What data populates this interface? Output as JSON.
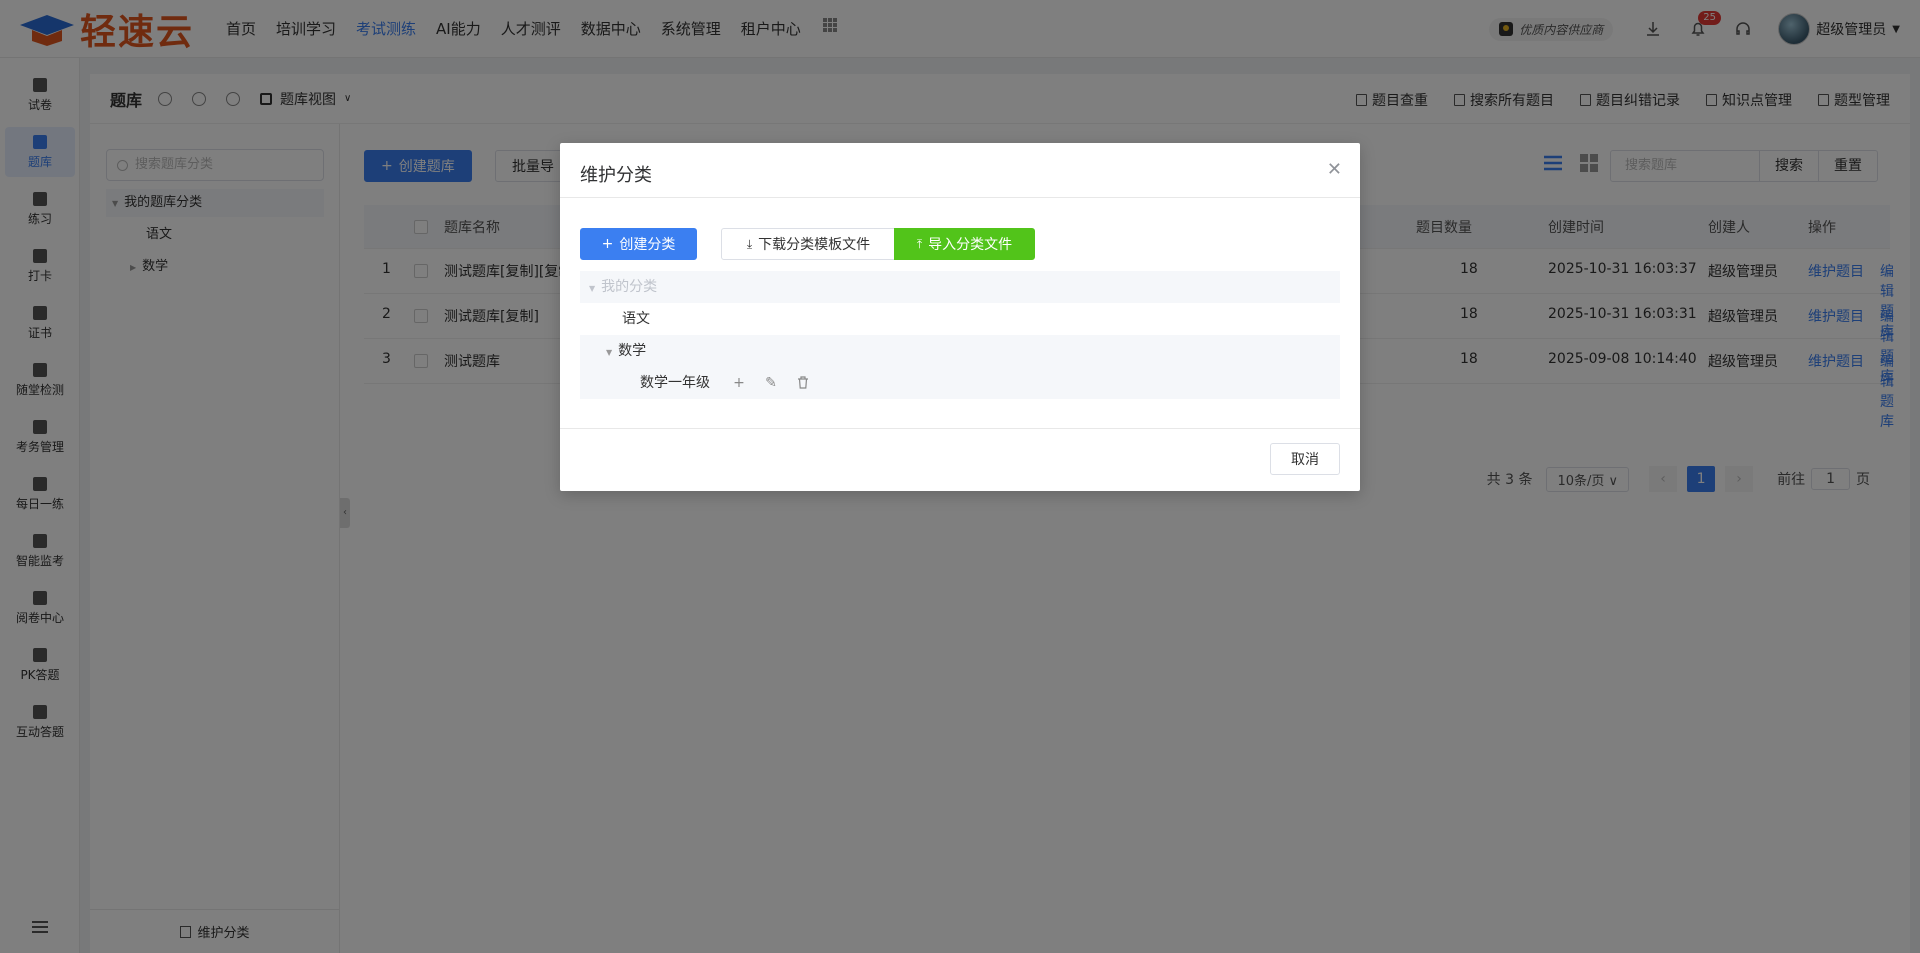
{
  "brand": {
    "name": "轻速云"
  },
  "topnav": {
    "items": [
      "首页",
      "培训学习",
      "考试测练",
      "AI能力",
      "人才测评",
      "数据中心",
      "系统管理",
      "租户中心"
    ],
    "active": "考试测练"
  },
  "top_right": {
    "vendor_label": "优质内容供应商",
    "notification_count": "25",
    "username": "超级管理员"
  },
  "sidebar": {
    "items": [
      {
        "label": "试卷",
        "icon": "paper-icon"
      },
      {
        "label": "题库",
        "icon": "question-bank-icon",
        "active": true
      },
      {
        "label": "练习",
        "icon": "pen-icon"
      },
      {
        "label": "打卡",
        "icon": "calendar-icon"
      },
      {
        "label": "证书",
        "icon": "certificate-icon"
      },
      {
        "label": "随堂检测",
        "icon": "monitor-icon"
      },
      {
        "label": "考务管理",
        "icon": "exam-admin-icon"
      },
      {
        "label": "每日一练",
        "icon": "daily-icon"
      },
      {
        "label": "智能监考",
        "icon": "proctor-icon"
      },
      {
        "label": "阅卷中心",
        "icon": "grading-icon"
      },
      {
        "label": "PK答题",
        "icon": "pk-icon"
      },
      {
        "label": "互动答题",
        "icon": "trophy-icon"
      }
    ]
  },
  "main": {
    "title": "题库",
    "view_selector": "题库视图",
    "actions": [
      "题目查重",
      "搜索所有题目",
      "题目纠错记录",
      "知识点管理",
      "题型管理"
    ]
  },
  "tree_panel": {
    "search_placeholder": "搜索题库分类",
    "root": "我的题库分类",
    "children": [
      "语文",
      "数学"
    ],
    "footer_button": "维护分类"
  },
  "toolbar": {
    "create_label": "创建题库",
    "batch_label": "批量导",
    "search_placeholder": "搜索题库",
    "search_button": "搜索",
    "reset_button": "重置"
  },
  "table": {
    "headers": {
      "name": "题库名称",
      "count": "题目数量",
      "created": "创建时间",
      "creator": "创建人",
      "ops": "操作"
    },
    "rows": [
      {
        "idx": "1",
        "name": "测试题库[复制][复制",
        "count": "18",
        "created": "2025-10-31 16:03:37",
        "creator": "超级管理员",
        "op1": "维护题目",
        "op2": "编辑题库"
      },
      {
        "idx": "2",
        "name": "测试题库[复制]",
        "count": "18",
        "created": "2025-10-31 16:03:31",
        "creator": "超级管理员",
        "op1": "维护题目",
        "op2": "编辑题库"
      },
      {
        "idx": "3",
        "name": "测试题库",
        "count": "18",
        "created": "2025-09-08 10:14:40",
        "creator": "超级管理员",
        "op1": "维护题目",
        "op2": "编辑题库"
      }
    ]
  },
  "pager": {
    "total": "共 3 条",
    "page_size": "10条/页",
    "current": "1",
    "goto_prefix": "前往",
    "goto_value": "1",
    "goto_suffix": "页"
  },
  "dialog": {
    "title": "维护分类",
    "create_button": "创建分类",
    "download_button": "下载分类模板文件",
    "import_button": "导入分类文件",
    "tree": {
      "root": "我的分类",
      "level1": [
        "语文",
        "数学"
      ],
      "level2": [
        "数学一年级"
      ]
    },
    "cancel_button": "取消"
  },
  "colors": {
    "accent": "#3b7ff1",
    "success": "#52c41a",
    "brand": "#e0561f"
  }
}
